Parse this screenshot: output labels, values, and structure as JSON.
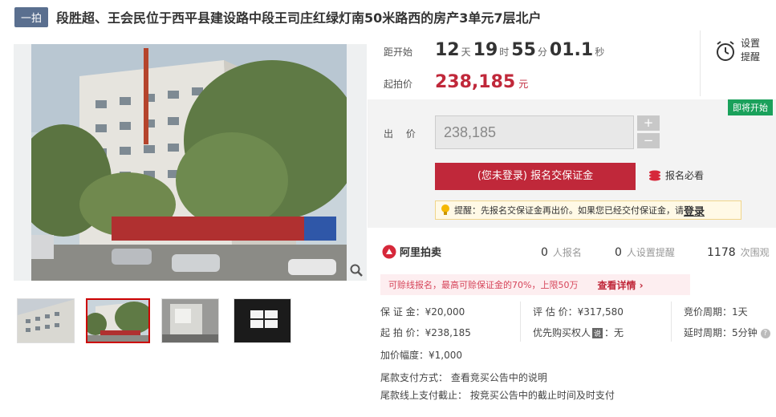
{
  "header": {
    "badge": "一拍",
    "title": "段胜超、王会民位于西平县建设路中段王司庄红绿灯南50米路西的房产3单元7层北户"
  },
  "countdown": {
    "label": "距开始",
    "days": "12",
    "days_unit": "天",
    "hours": "19",
    "hours_unit": "时",
    "minutes": "55",
    "minutes_unit": "分",
    "seconds": "01.1",
    "seconds_unit": "秒"
  },
  "start_price": {
    "label": "起拍价",
    "value": "238,185",
    "unit": "元"
  },
  "remind": {
    "label": "设置提醒",
    "icon": "alarm-clock-icon"
  },
  "bid": {
    "status_badge": "即将开始",
    "label": "出 价",
    "value": "238,185",
    "plus": "+",
    "minus": "−",
    "register_button": "(您未登录) 报名交保证金",
    "must_read": "报名必看",
    "tip_text": "提醒：先报名交保证金再出价。如果您已经交付保证金，请",
    "tip_link": "登录"
  },
  "stats": {
    "logo_text": "阿里拍卖",
    "registered_count": "0",
    "registered_label": "人报名",
    "reminder_count": "0",
    "reminder_label": "人设置提醒",
    "views_count": "1178",
    "views_label": "次围观"
  },
  "promo": {
    "text": "可赊线报名，最高可赊保证金的70%，上限50万",
    "link": "查看详情"
  },
  "details": {
    "deposit": "保 证 金：¥20,000",
    "assess": "评 估 价：¥317,580",
    "cycle": "竞价周期：1天",
    "start": "起 拍 价：¥238,185",
    "priority_k": "优先购买权人",
    "priority_tag": "说",
    "priority_v": "：无",
    "delay": "延时周期：5分钟",
    "increment": "加价幅度：¥1,000",
    "pay_method": "尾款支付方式：  查看竞买公告中的说明",
    "pay_deadline": "尾款线上支付截止：  按竞买公告中的截止时间及时支付"
  }
}
